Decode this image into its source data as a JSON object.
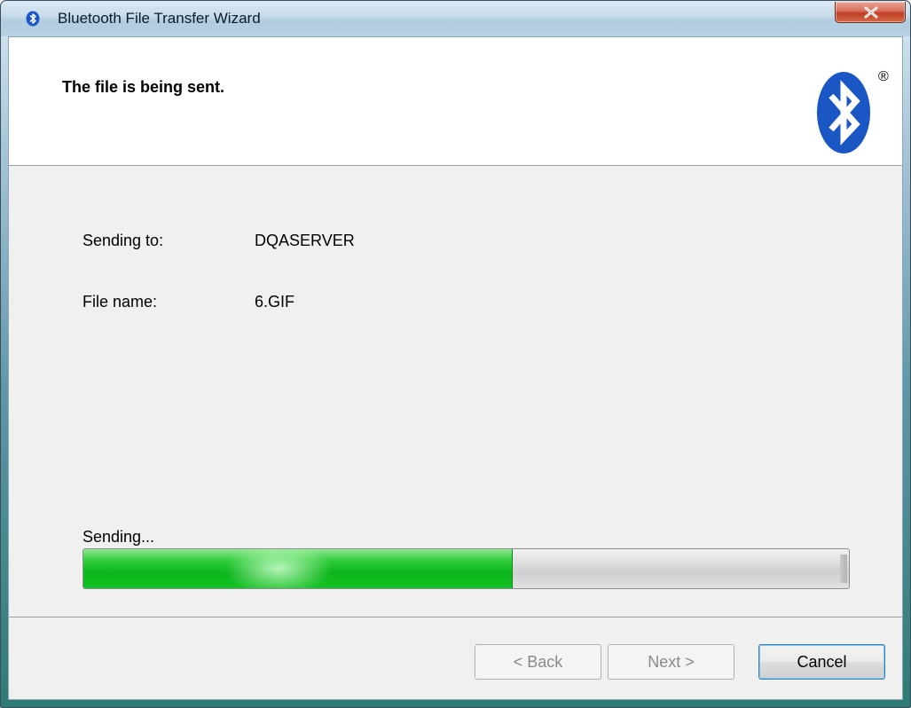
{
  "window": {
    "title": "Bluetooth File Transfer Wizard"
  },
  "header": {
    "title": "The file is being sent.",
    "logo_icon": "bluetooth-logo-icon",
    "registered_mark": "®"
  },
  "details": {
    "sending_to_label": "Sending to:",
    "sending_to_value": "DQASERVER",
    "file_name_label": "File name:",
    "file_name_value": "6.GIF"
  },
  "progress": {
    "label": "Sending...",
    "percent": 56,
    "fill_color": "#13c224"
  },
  "buttons": {
    "back_label": "< Back",
    "next_label": "Next >",
    "cancel_label": "Cancel"
  },
  "colors": {
    "bluetooth_blue": "#1a56c4",
    "close_red": "#c03f24"
  }
}
